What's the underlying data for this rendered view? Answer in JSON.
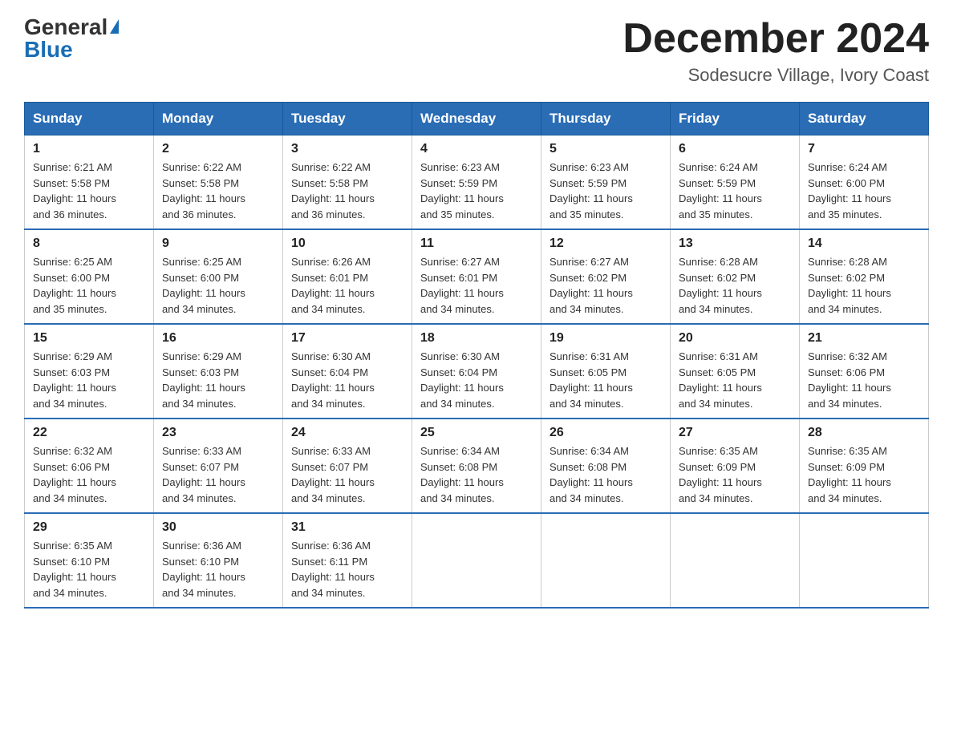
{
  "logo": {
    "general": "General",
    "blue": "Blue"
  },
  "title": "December 2024",
  "location": "Sodesucre Village, Ivory Coast",
  "days_of_week": [
    "Sunday",
    "Monday",
    "Tuesday",
    "Wednesday",
    "Thursday",
    "Friday",
    "Saturday"
  ],
  "weeks": [
    [
      {
        "day": "1",
        "sunrise": "6:21 AM",
        "sunset": "5:58 PM",
        "daylight": "11 hours and 36 minutes."
      },
      {
        "day": "2",
        "sunrise": "6:22 AM",
        "sunset": "5:58 PM",
        "daylight": "11 hours and 36 minutes."
      },
      {
        "day": "3",
        "sunrise": "6:22 AM",
        "sunset": "5:58 PM",
        "daylight": "11 hours and 36 minutes."
      },
      {
        "day": "4",
        "sunrise": "6:23 AM",
        "sunset": "5:59 PM",
        "daylight": "11 hours and 35 minutes."
      },
      {
        "day": "5",
        "sunrise": "6:23 AM",
        "sunset": "5:59 PM",
        "daylight": "11 hours and 35 minutes."
      },
      {
        "day": "6",
        "sunrise": "6:24 AM",
        "sunset": "5:59 PM",
        "daylight": "11 hours and 35 minutes."
      },
      {
        "day": "7",
        "sunrise": "6:24 AM",
        "sunset": "6:00 PM",
        "daylight": "11 hours and 35 minutes."
      }
    ],
    [
      {
        "day": "8",
        "sunrise": "6:25 AM",
        "sunset": "6:00 PM",
        "daylight": "11 hours and 35 minutes."
      },
      {
        "day": "9",
        "sunrise": "6:25 AM",
        "sunset": "6:00 PM",
        "daylight": "11 hours and 34 minutes."
      },
      {
        "day": "10",
        "sunrise": "6:26 AM",
        "sunset": "6:01 PM",
        "daylight": "11 hours and 34 minutes."
      },
      {
        "day": "11",
        "sunrise": "6:27 AM",
        "sunset": "6:01 PM",
        "daylight": "11 hours and 34 minutes."
      },
      {
        "day": "12",
        "sunrise": "6:27 AM",
        "sunset": "6:02 PM",
        "daylight": "11 hours and 34 minutes."
      },
      {
        "day": "13",
        "sunrise": "6:28 AM",
        "sunset": "6:02 PM",
        "daylight": "11 hours and 34 minutes."
      },
      {
        "day": "14",
        "sunrise": "6:28 AM",
        "sunset": "6:02 PM",
        "daylight": "11 hours and 34 minutes."
      }
    ],
    [
      {
        "day": "15",
        "sunrise": "6:29 AM",
        "sunset": "6:03 PM",
        "daylight": "11 hours and 34 minutes."
      },
      {
        "day": "16",
        "sunrise": "6:29 AM",
        "sunset": "6:03 PM",
        "daylight": "11 hours and 34 minutes."
      },
      {
        "day": "17",
        "sunrise": "6:30 AM",
        "sunset": "6:04 PM",
        "daylight": "11 hours and 34 minutes."
      },
      {
        "day": "18",
        "sunrise": "6:30 AM",
        "sunset": "6:04 PM",
        "daylight": "11 hours and 34 minutes."
      },
      {
        "day": "19",
        "sunrise": "6:31 AM",
        "sunset": "6:05 PM",
        "daylight": "11 hours and 34 minutes."
      },
      {
        "day": "20",
        "sunrise": "6:31 AM",
        "sunset": "6:05 PM",
        "daylight": "11 hours and 34 minutes."
      },
      {
        "day": "21",
        "sunrise": "6:32 AM",
        "sunset": "6:06 PM",
        "daylight": "11 hours and 34 minutes."
      }
    ],
    [
      {
        "day": "22",
        "sunrise": "6:32 AM",
        "sunset": "6:06 PM",
        "daylight": "11 hours and 34 minutes."
      },
      {
        "day": "23",
        "sunrise": "6:33 AM",
        "sunset": "6:07 PM",
        "daylight": "11 hours and 34 minutes."
      },
      {
        "day": "24",
        "sunrise": "6:33 AM",
        "sunset": "6:07 PM",
        "daylight": "11 hours and 34 minutes."
      },
      {
        "day": "25",
        "sunrise": "6:34 AM",
        "sunset": "6:08 PM",
        "daylight": "11 hours and 34 minutes."
      },
      {
        "day": "26",
        "sunrise": "6:34 AM",
        "sunset": "6:08 PM",
        "daylight": "11 hours and 34 minutes."
      },
      {
        "day": "27",
        "sunrise": "6:35 AM",
        "sunset": "6:09 PM",
        "daylight": "11 hours and 34 minutes."
      },
      {
        "day": "28",
        "sunrise": "6:35 AM",
        "sunset": "6:09 PM",
        "daylight": "11 hours and 34 minutes."
      }
    ],
    [
      {
        "day": "29",
        "sunrise": "6:35 AM",
        "sunset": "6:10 PM",
        "daylight": "11 hours and 34 minutes."
      },
      {
        "day": "30",
        "sunrise": "6:36 AM",
        "sunset": "6:10 PM",
        "daylight": "11 hours and 34 minutes."
      },
      {
        "day": "31",
        "sunrise": "6:36 AM",
        "sunset": "6:11 PM",
        "daylight": "11 hours and 34 minutes."
      },
      null,
      null,
      null,
      null
    ]
  ],
  "labels": {
    "sunrise": "Sunrise:",
    "sunset": "Sunset:",
    "daylight": "Daylight:"
  }
}
